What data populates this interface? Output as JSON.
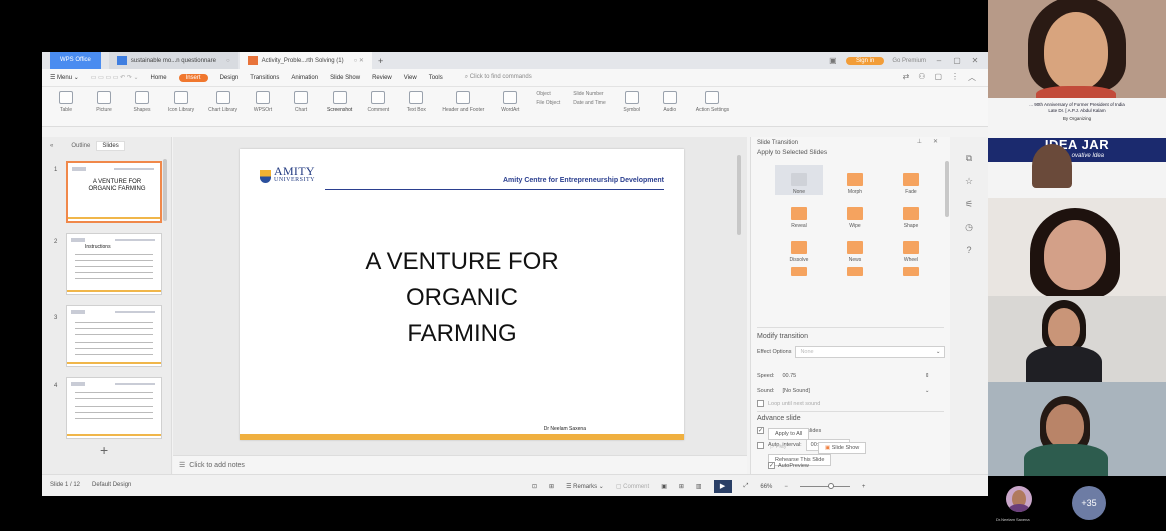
{
  "tabs": {
    "office": "WPS Office",
    "doc1": "sustainable mo...n questionnare",
    "doc2": "Activity_Proble...rth Solving (1)",
    "new_tab": "+"
  },
  "titlebar": {
    "sign_in": "Sign in",
    "go_premium": "Go Premium"
  },
  "menu": {
    "menu_label": "Menu",
    "items": [
      "Home",
      "Insert",
      "Design",
      "Transitions",
      "Animation",
      "Slide Show",
      "Review",
      "View",
      "Tools"
    ],
    "find_placeholder": "Click to find commands"
  },
  "ribbon": {
    "buttons": [
      "Table",
      "Picture",
      "Shapes",
      "Icon Library",
      "Chart Library",
      "WPSOrt",
      "Chart",
      "Screenshot",
      "Comment",
      "Text Box",
      "Header and Footer",
      "WordArt",
      "Symbol",
      "Audio",
      "Action Settings"
    ],
    "object": "Object",
    "file_object": "File Object",
    "slide_number": "Slide Number",
    "date_time": "Date and Time"
  },
  "left_panel": {
    "tab_outline": "Outline",
    "tab_slides": "Slides",
    "thumbs": [
      {
        "num": "1",
        "title": "A VENTURE FOR ORGANIC FARMING"
      },
      {
        "num": "2",
        "title": "Instructions"
      },
      {
        "num": "3",
        "title": ""
      },
      {
        "num": "4",
        "title": ""
      }
    ],
    "add_slide": "+"
  },
  "slide": {
    "logo_top": "AMITY",
    "logo_bottom": "UNIVERSITY",
    "header": "Amity Centre for Entrepreneurship Development",
    "title_line1": "A VENTURE FOR",
    "title_line2": "ORGANIC",
    "title_line3": "FARMING",
    "author": "Dr Neelam Saxena"
  },
  "notes": {
    "placeholder": "Click to add notes"
  },
  "task_pane": {
    "title": "Slide Transition",
    "apply_to": "Apply to Selected Slides",
    "transitions": [
      "None",
      "Morph",
      "Fade",
      "Reveal",
      "Wipe",
      "Shape",
      "Dissolve",
      "News",
      "Wheel",
      "",
      "",
      ""
    ],
    "modify": "Modify transition",
    "effect_options_label": "Effect Options",
    "effect_options_value": "None",
    "speed_label": "Speed:",
    "speed_value": "00.75",
    "sound_label": "Sound:",
    "sound_value": "[No Sound]",
    "loop": "Loop until next sound",
    "advance": "Advance slide",
    "on_click": "Click to change slides",
    "auto_interval": "Auto, interval:",
    "auto_value": "00:00",
    "rehearse": "Rehearse This Slide",
    "apply_all": "Apply to All",
    "play": "Play",
    "slide_show": "Slide Show",
    "autopreview": "AutoPreview"
  },
  "statusbar": {
    "slide_count": "Slide 1 / 12",
    "design": "Default Design",
    "remarks": "Remarks",
    "comment": "Comment",
    "zoom": "66%"
  },
  "video": {
    "idea_line1": "... 90th Anniversary of Former President of India",
    "idea_line2": "Late Dr. [ A.P.J. Abdul Kalam",
    "idea_org": "By Organizing",
    "idea_title": "IDEA JAR",
    "idea_sub": "Pitch ... ovative Idea",
    "bottom_name": "Dr.Neelam Saxena",
    "more_count": "+35"
  },
  "colors": {
    "wps_tab": "#4a8cf0",
    "insert_tab": "#f0772e",
    "amity_blue": "#2b3f8f",
    "slide_bar": "#f0b040",
    "idea_banner": "#1b2a6e"
  }
}
